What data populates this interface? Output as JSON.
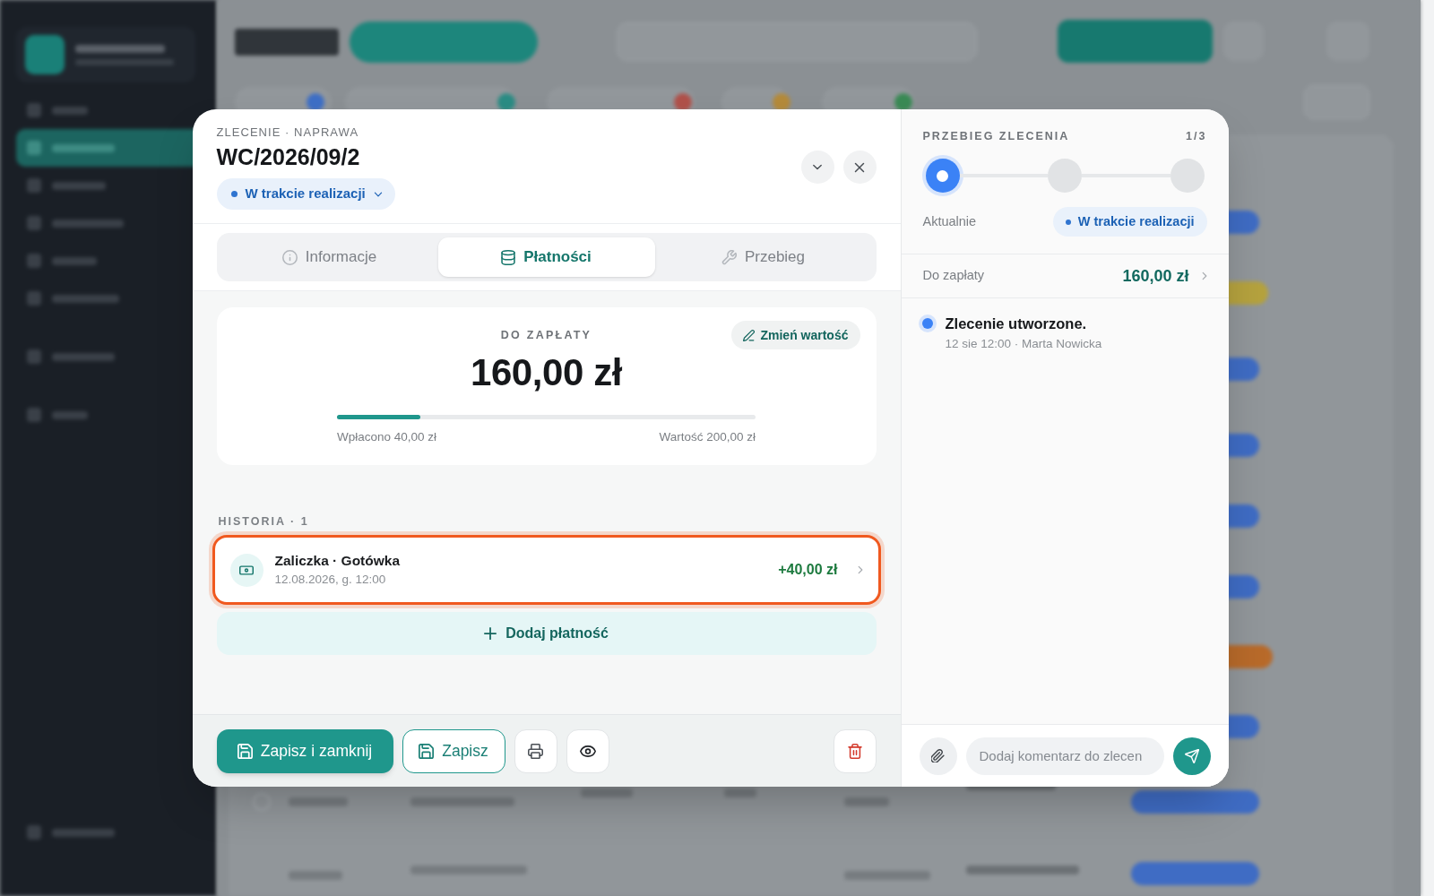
{
  "order": {
    "eyebrow": "ZLECENIE · NAPRAWA",
    "title": "WC/2026/09/2",
    "status": "W trakcie realizacji"
  },
  "tabs": [
    {
      "label": "Informacje",
      "selected": false
    },
    {
      "label": "Płatności",
      "selected": true
    },
    {
      "label": "Przebieg",
      "selected": false
    }
  ],
  "payment_summary": {
    "label": "DO ZAPŁATY",
    "amount": "160,00 zł",
    "edit_button": "Zmień wartość",
    "level": 0.2,
    "paid": "Wpłacono 40,00 zł",
    "total": "Wartość 200,00 zł"
  },
  "history": {
    "heading": "HISTORIA · 1",
    "items": [
      {
        "title": "Zaliczka · Gotówka",
        "date": "12.08.2026, g. 12:00",
        "amount": "+40,00 zł",
        "selected": true
      }
    ]
  },
  "add_payment_button": "Dodaj płatność",
  "footer_buttons": {
    "save_and_close": "Zapisz i zamknij",
    "save": "Zapisz"
  },
  "progress": {
    "heading": "PRZEBIEG ZLECENIA",
    "counter": "1/3",
    "steps": [
      {
        "selected": true
      },
      {
        "selected": false
      },
      {
        "selected": false
      }
    ],
    "current_label": "Aktualnie",
    "current_status": "W trakcie realizacji"
  },
  "amount_due": {
    "label": "Do zapłaty",
    "value": "160,00 zł"
  },
  "timeline": [
    {
      "title": "Zlecenie utworzone.",
      "meta": "12 sie 12:00 · Marta Nowicka"
    }
  ],
  "comment": {
    "placeholder": "Dodaj komentarz do zlecen"
  }
}
